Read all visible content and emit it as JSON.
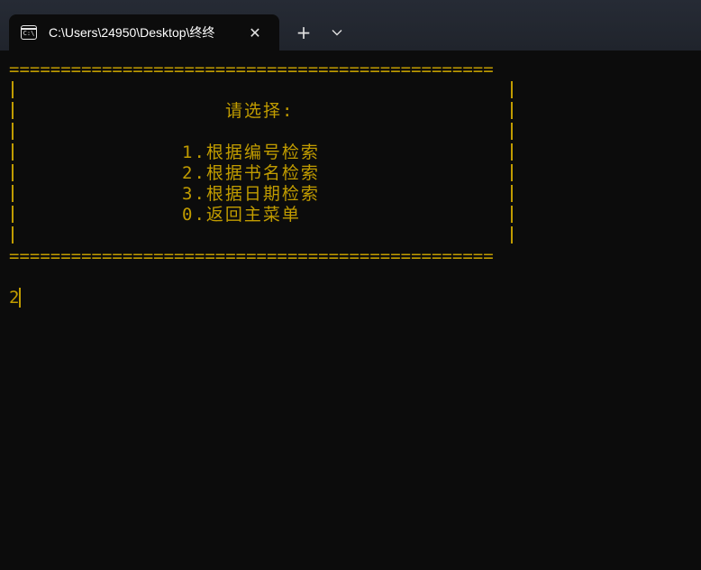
{
  "window": {
    "tab_title": "C:\\Users\\24950\\Desktop\\终终",
    "tab_icon": "terminal-icon",
    "close_icon": "close-icon",
    "new_tab_label": "+",
    "dropdown_icon": "chevron-down-icon"
  },
  "terminal": {
    "border_line": "===============================================",
    "prompt_title": "请选择:",
    "options": [
      "1.根据编号检索",
      "2.根据书名检索",
      "3.根据日期检索",
      "0.返回主菜单"
    ],
    "input_value": "2",
    "text_color": "#c19c00",
    "background": "#0c0c0c"
  }
}
